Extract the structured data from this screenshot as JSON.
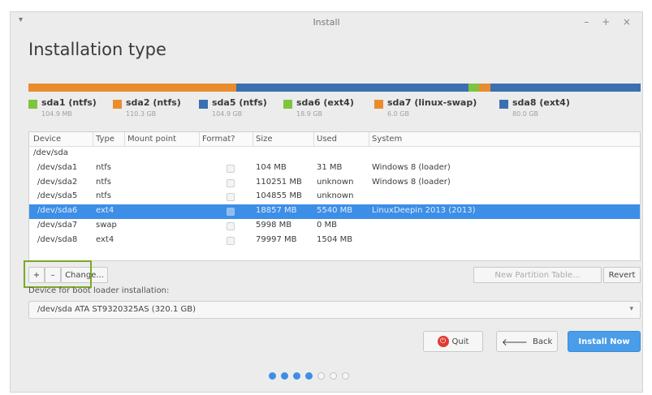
{
  "window": {
    "title": "Install",
    "menu_icon": "▾",
    "controls": "– + ×"
  },
  "page": {
    "heading": "Installation type"
  },
  "partition_bar": [
    {
      "name": "sda1",
      "color": "#7ec43f",
      "fraction": 0.0003
    },
    {
      "name": "sda2",
      "color": "#e88c2e",
      "fraction": 0.343
    },
    {
      "name": "sda5",
      "color": "#3b6fb0",
      "fraction": 0.326
    },
    {
      "name": "sda6",
      "color": "#3b6fb0",
      "fraction": 0.0587
    },
    {
      "name": "sda6",
      "color": "#7ec43f",
      "fraction": 0.0172
    },
    {
      "name": "sda7",
      "color": "#e88c2e",
      "fraction": 0.0187
    },
    {
      "name": "sda8",
      "color": "#3b6fb0",
      "fraction": 0.249
    }
  ],
  "legend": [
    {
      "name": "sda1 (ntfs)",
      "size": "104.9 MB",
      "color": "#7ec43f"
    },
    {
      "name": "sda2 (ntfs)",
      "size": "110.3 GB",
      "color": "#e88c2e"
    },
    {
      "name": "sda5 (ntfs)",
      "size": "104.9 GB",
      "color": "#3b6fb0"
    },
    {
      "name": "sda6 (ext4)",
      "size": "18.9 GB",
      "color": "#7ec43f"
    },
    {
      "name": "sda7 (linux-swap)",
      "size": "6.0 GB",
      "color": "#e88c2e"
    },
    {
      "name": "sda8 (ext4)",
      "size": "80.0 GB",
      "color": "#3b6fb0"
    }
  ],
  "table": {
    "headers": [
      "Device",
      "Type",
      "Mount point",
      "Format?",
      "Size",
      "Used",
      "System"
    ],
    "disk": "/dev/sda",
    "rows": [
      {
        "device": "/dev/sda1",
        "type": "ntfs",
        "mount": "",
        "size": "104 MB",
        "used": "31 MB",
        "system": "Windows 8 (loader)",
        "selected": false
      },
      {
        "device": "/dev/sda2",
        "type": "ntfs",
        "mount": "",
        "size": "110251 MB",
        "used": "unknown",
        "system": "Windows 8 (loader)",
        "selected": false
      },
      {
        "device": "/dev/sda5",
        "type": "ntfs",
        "mount": "",
        "size": "104855 MB",
        "used": "unknown",
        "system": "",
        "selected": false
      },
      {
        "device": "/dev/sda6",
        "type": "ext4",
        "mount": "",
        "size": "18857 MB",
        "used": "5540 MB",
        "system": "LinuxDeepin 2013 (2013)",
        "selected": true
      },
      {
        "device": "/dev/sda7",
        "type": "swap",
        "mount": "",
        "size": "5998 MB",
        "used": "0 MB",
        "system": "",
        "selected": false
      },
      {
        "device": "/dev/sda8",
        "type": "ext4",
        "mount": "",
        "size": "79997 MB",
        "used": "1504 MB",
        "system": "",
        "selected": false
      }
    ]
  },
  "table_buttons": {
    "add": "+",
    "remove": "–",
    "change": "Change...",
    "new_table": "New Partition Table...",
    "revert": "Revert"
  },
  "boot": {
    "label": "Device for boot loader installation:",
    "value": "/dev/sda   ATA ST9320325AS (320.1 GB)",
    "arrow": "▾"
  },
  "actions": {
    "quit": "Quit",
    "back": "Back",
    "install": "Install Now",
    "quit_icon": "⏻",
    "back_icon": "🡐"
  },
  "progress_dots": {
    "total": 7,
    "current": 4
  }
}
